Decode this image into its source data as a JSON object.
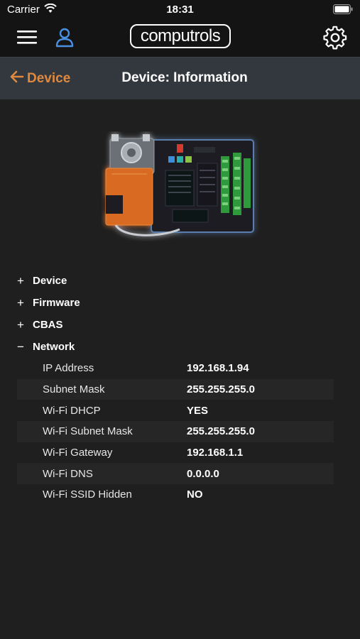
{
  "status_bar": {
    "carrier": "Carrier",
    "time": "18:31"
  },
  "top_nav": {
    "logo_text": "computrols",
    "icons": [
      "menu-icon",
      "profile-icon",
      "gear-icon"
    ],
    "profile_icon_color": "#4a90e2"
  },
  "page_header": {
    "back_label": "Device",
    "title": "Device: Information",
    "accent_color": "#e0893e"
  },
  "sections": [
    {
      "label": "Device",
      "expanded": false,
      "toggle": "+"
    },
    {
      "label": "Firmware",
      "expanded": false,
      "toggle": "+"
    },
    {
      "label": "CBAS",
      "expanded": false,
      "toggle": "+"
    },
    {
      "label": "Network",
      "expanded": true,
      "toggle": "−"
    }
  ],
  "network": {
    "rows": [
      {
        "label": "IP Address",
        "value": "192.168.1.94"
      },
      {
        "label": "Subnet Mask",
        "value": "255.255.255.0"
      },
      {
        "label": "Wi-Fi DHCP",
        "value": "YES"
      },
      {
        "label": "Wi-Fi Subnet Mask",
        "value": "255.255.255.0"
      },
      {
        "label": "Wi-Fi Gateway",
        "value": "192.168.1.1"
      },
      {
        "label": "Wi-Fi DNS",
        "value": "0.0.0.0"
      },
      {
        "label": "Wi-Fi SSID Hidden",
        "value": "NO"
      }
    ]
  }
}
